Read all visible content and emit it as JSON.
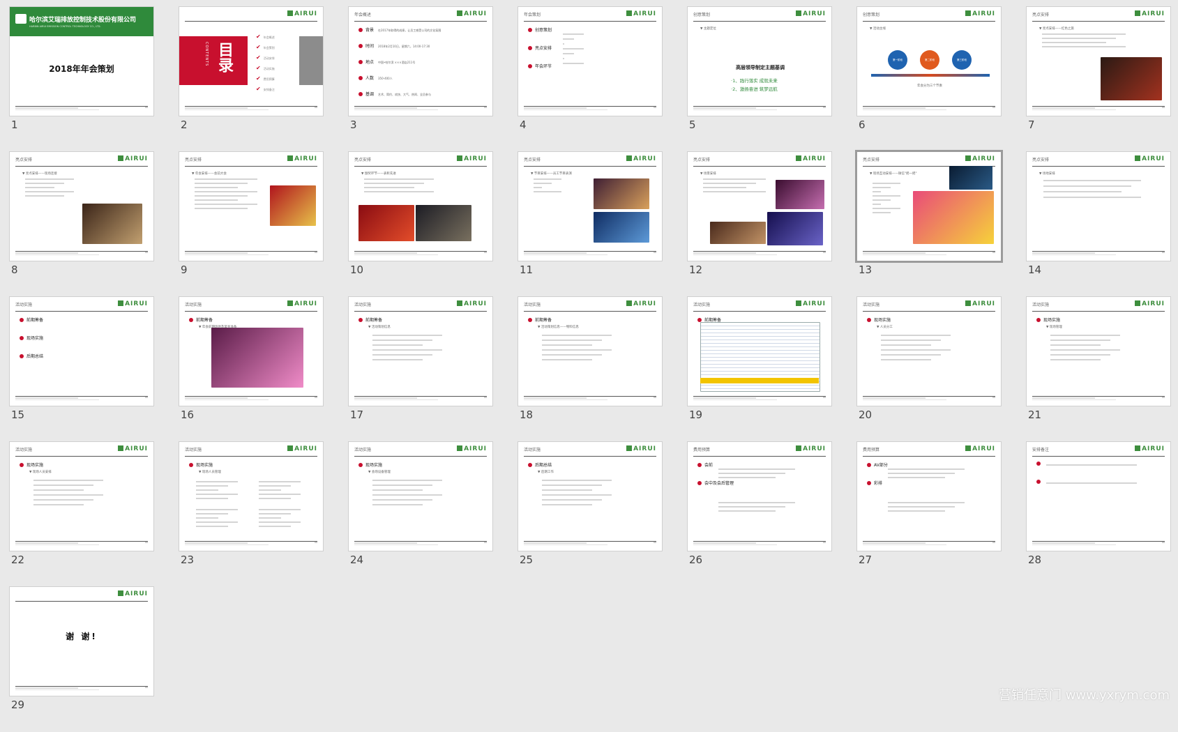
{
  "logo_text": "AIRUI",
  "slides": [
    {
      "n": "1",
      "kind": "cover",
      "brand": "哈尔滨艾瑞排放控制技术股份有限公司",
      "brand_en": "HARBIN AIRUI EMISSION CONTROL TECHNOLOGY CO., LTD.",
      "title": "2018年年会策划"
    },
    {
      "n": "2",
      "kind": "contents",
      "big": "目录",
      "en": "CONTENTS",
      "items": [
        "年会概述",
        "年会策划",
        "活动安排",
        "活动实施",
        "费用预算",
        "安排备注"
      ]
    },
    {
      "n": "3",
      "kind": "list",
      "title": "年会概述",
      "bullets": [
        "背景",
        "时间",
        "地点",
        "人数",
        "基调"
      ],
      "subs": [
        "在2017年取得的成绩，让员工感受公司的文化氛围",
        "2018年2月10日，星期六，14:00-17:30",
        "中国•哈尔滨 ×××酒店211号",
        "350-400人",
        "艺术、简约、欢快、大气、热闹、全员参与"
      ]
    },
    {
      "n": "4",
      "kind": "list",
      "title": "年会策划",
      "bullets": [
        "创意策划",
        "亮点安排",
        "年会环节"
      ]
    },
    {
      "n": "5",
      "kind": "theme",
      "title": "创意策划",
      "sub": "主题定位",
      "head": "高层领导制定主题基调",
      "g1": "·1、践行落实 成就未来",
      "g2": "·2、激扬奋进 筑梦远航"
    },
    {
      "n": "6",
      "kind": "circles",
      "title": "创意策划",
      "sub": "活动主线",
      "c1": "第一阶段",
      "c2": "第二阶段",
      "c3": "第三阶段",
      "note": "年会分为三个节奏"
    },
    {
      "n": "7",
      "kind": "photo",
      "title": "亮点安排",
      "sub": "亮点安排——红色之旅"
    },
    {
      "n": "8",
      "kind": "photo",
      "title": "亮点安排",
      "sub": "亮点安排——现场连接"
    },
    {
      "n": "9",
      "kind": "photo",
      "title": "亮点安排",
      "sub": "年会安排——会前大会"
    },
    {
      "n": "10",
      "kind": "photo",
      "title": "亮点安排",
      "sub": "颁奖环节——表彰先进"
    },
    {
      "n": "11",
      "kind": "photo",
      "title": "亮点安排",
      "sub": "节目安排——员工节目表演"
    },
    {
      "n": "12",
      "kind": "photo",
      "title": "亮点安排",
      "sub": "场景安排"
    },
    {
      "n": "13",
      "kind": "photo",
      "title": "亮点安排",
      "sub": "现场互动安排——微信\"摇一摇\""
    },
    {
      "n": "14",
      "kind": "text",
      "title": "亮点安排",
      "sub": "场地安排"
    },
    {
      "n": "15",
      "kind": "list",
      "title": "活动实施",
      "bullets": [
        "前期筹备",
        "现场实施",
        "后期总结"
      ]
    },
    {
      "n": "16",
      "kind": "photo",
      "title": "活动实施",
      "bullets": [
        "前期筹备"
      ],
      "sub": "年会前期场地及宴会准备"
    },
    {
      "n": "17",
      "kind": "list",
      "title": "活动实施",
      "bullets": [
        "前期筹备"
      ],
      "sub": "活动策划信息"
    },
    {
      "n": "18",
      "kind": "list",
      "title": "活动实施",
      "bullets": [
        "前期筹备"
      ],
      "sub": "活动策划信息——物料信息"
    },
    {
      "n": "19",
      "kind": "table",
      "title": "活动实施",
      "bullets": [
        "前期筹备"
      ],
      "sub": "活动清单"
    },
    {
      "n": "20",
      "kind": "list",
      "title": "活动实施",
      "bullets": [
        "现场实施"
      ],
      "sub": "人员分工"
    },
    {
      "n": "21",
      "kind": "list",
      "title": "活动实施",
      "bullets": [
        "现场实施"
      ],
      "sub": "现场管理"
    },
    {
      "n": "22",
      "kind": "list",
      "title": "活动实施",
      "bullets": [
        "现场实施"
      ],
      "sub": "现场人员安排"
    },
    {
      "n": "23",
      "kind": "list",
      "title": "活动实施",
      "bullets": [
        "现场实施"
      ],
      "sub": "现场人员管理"
    },
    {
      "n": "24",
      "kind": "list",
      "title": "活动实施",
      "bullets": [
        "现场实施"
      ],
      "sub": "会场设备管理"
    },
    {
      "n": "25",
      "kind": "list",
      "title": "活动实施",
      "bullets": [
        "后期总结"
      ],
      "sub": "后期工作"
    },
    {
      "n": "26",
      "kind": "list",
      "title": "费用预算",
      "bullets": [
        "会前",
        "会中及会后管理"
      ]
    },
    {
      "n": "27",
      "kind": "list",
      "title": "费用预算",
      "bullets": [
        "AV部分",
        "彩排"
      ]
    },
    {
      "n": "28",
      "kind": "list",
      "title": "安排备注",
      "bullets": [
        "",
        ""
      ]
    },
    {
      "n": "29",
      "kind": "end",
      "title": "谢 谢!"
    }
  ],
  "watermark": "营销任意门 www.yxrym.com",
  "selected_slide": "13"
}
